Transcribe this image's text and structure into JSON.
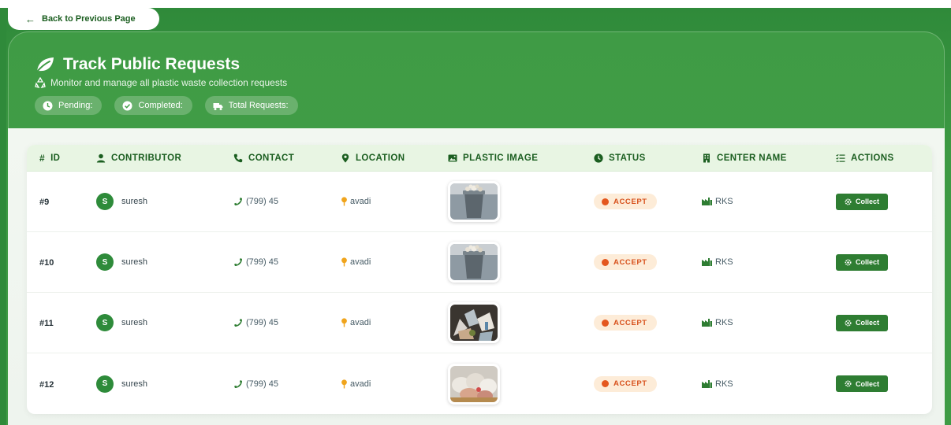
{
  "nav": {
    "back_label": "Back to Previous Page"
  },
  "header": {
    "title": "Track Public Requests",
    "subtitle": "Monitor and manage all plastic waste collection requests",
    "stats": [
      {
        "icon": "clock-icon",
        "label": "Pending:"
      },
      {
        "icon": "check-circle-icon",
        "label": "Completed:"
      },
      {
        "icon": "truck-icon",
        "label": "Total Requests:"
      }
    ]
  },
  "table": {
    "columns": [
      {
        "icon": "hash-icon",
        "label": "ID"
      },
      {
        "icon": "user-icon",
        "label": "CONTRIBUTOR"
      },
      {
        "icon": "phone-icon",
        "label": "CONTACT"
      },
      {
        "icon": "map-pin-icon",
        "label": "LOCATION"
      },
      {
        "icon": "image-icon",
        "label": "PLASTIC IMAGE"
      },
      {
        "icon": "clock-icon",
        "label": "STATUS"
      },
      {
        "icon": "building-icon",
        "label": "CENTER NAME"
      },
      {
        "icon": "list-check-icon",
        "label": "ACTIONS"
      }
    ],
    "rows": [
      {
        "id": "#9",
        "avatar": "S",
        "contributor": "suresh",
        "contact": "(799) 45",
        "location": "avadi",
        "image": "trash-bin-photo",
        "status": "ACCEPT",
        "center": "RKS",
        "action": "Collect"
      },
      {
        "id": "#10",
        "avatar": "S",
        "contributor": "suresh",
        "contact": "(799) 45",
        "location": "avadi",
        "image": "trash-bin-photo",
        "status": "ACCEPT",
        "center": "RKS",
        "action": "Collect"
      },
      {
        "id": "#11",
        "avatar": "S",
        "contributor": "suresh",
        "contact": "(799) 45",
        "location": "avadi",
        "image": "plastic-pile-photo",
        "status": "ACCEPT",
        "center": "RKS",
        "action": "Collect"
      },
      {
        "id": "#12",
        "avatar": "S",
        "contributor": "suresh",
        "contact": "(799) 45",
        "location": "avadi",
        "image": "plastic-bags-photo",
        "status": "ACCEPT",
        "center": "RKS",
        "action": "Collect"
      }
    ]
  },
  "colors": {
    "primary_green": "#2e7d32",
    "header_green": "#3f9b45",
    "status_orange": "#d7501b",
    "status_bg": "#fdecd8"
  }
}
